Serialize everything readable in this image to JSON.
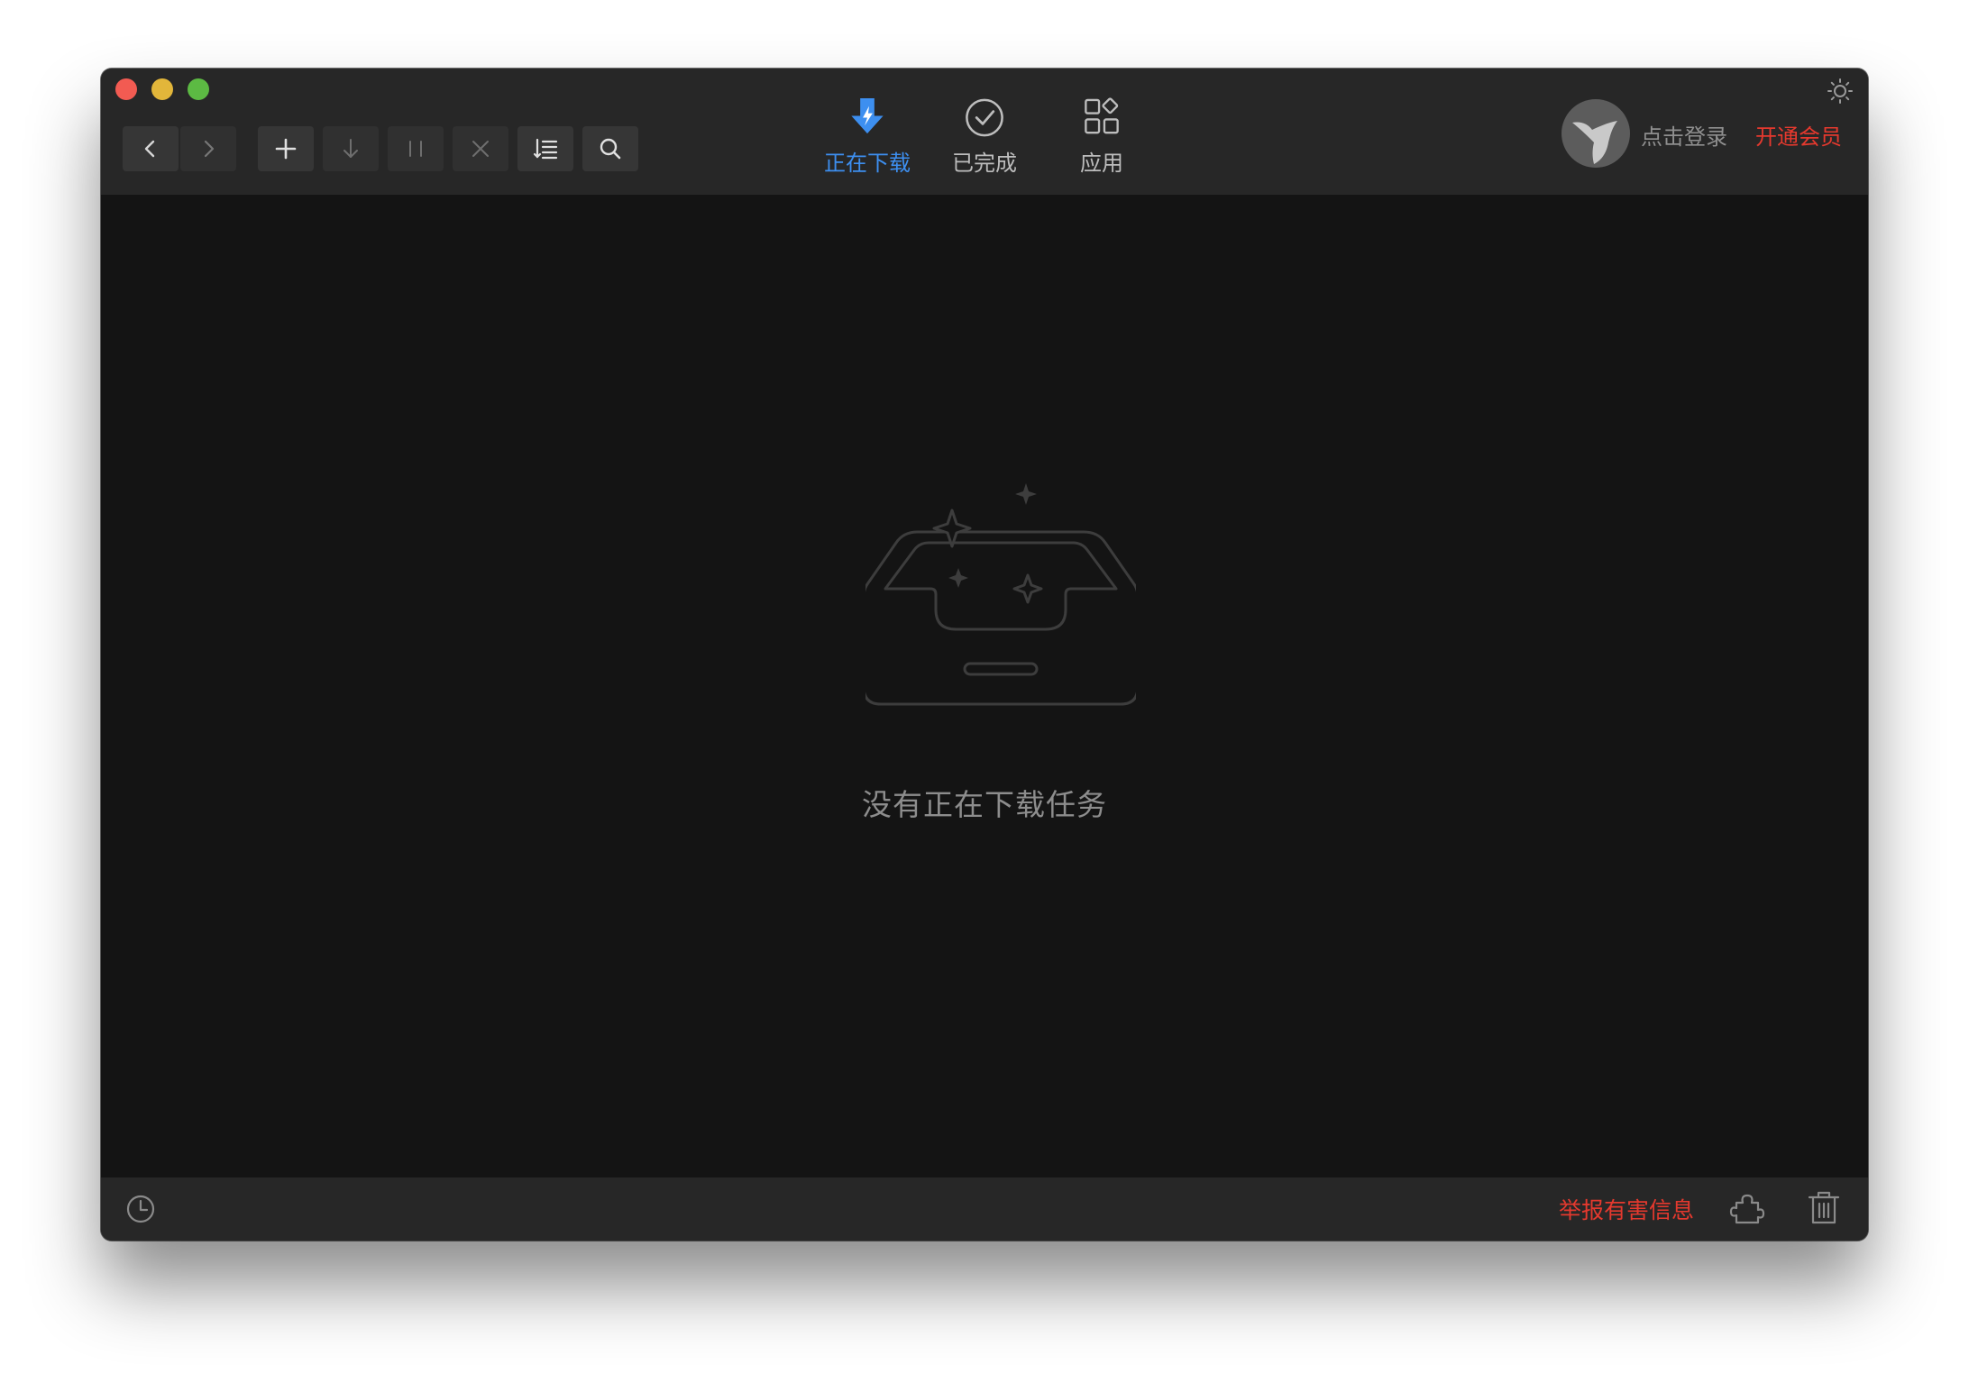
{
  "toolbar": {
    "back_icon": "chevron-left-icon",
    "forward_icon": "chevron-right-icon",
    "new_task_icon": "plus-icon",
    "start_icon": "arrow-down-icon",
    "pause_icon": "pause-icon",
    "delete_icon": "close-icon",
    "sort_icon": "sort-list-icon",
    "search_icon": "search-icon"
  },
  "tabs": [
    {
      "label": "正在下载",
      "icon": "download-bolt-icon",
      "active": true
    },
    {
      "label": "已完成",
      "icon": "check-circle-icon",
      "active": false
    },
    {
      "label": "应用",
      "icon": "apps-grid-icon",
      "active": false
    }
  ],
  "user": {
    "login_label": "点击登录",
    "vip_label": "开通会员"
  },
  "main": {
    "empty_message": "没有正在下载任务",
    "empty_icon": "empty-inbox-icon"
  },
  "footer": {
    "report_label": "举报有害信息",
    "history_icon": "clock-icon",
    "plugin_icon": "puzzle-icon",
    "trash_icon": "trash-icon"
  },
  "colors": {
    "accent": "#3d8ff0",
    "warning": "#e5392e",
    "content_bg": "#141414",
    "bar_bg": "#272727"
  }
}
